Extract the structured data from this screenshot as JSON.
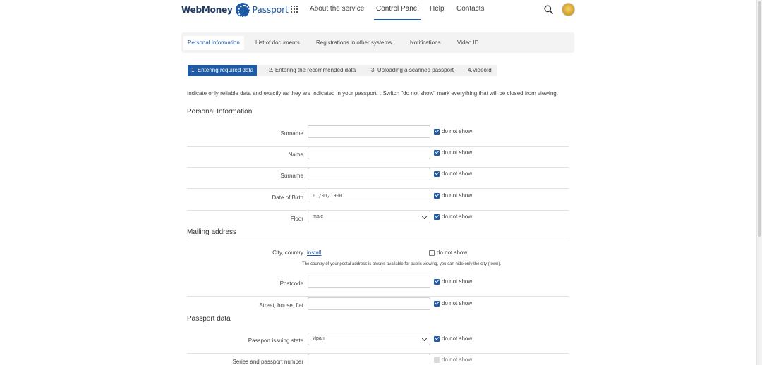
{
  "header": {
    "logo_text": "WebMoney",
    "logo_product": "Passport",
    "nav": [
      "About the service",
      "Control Panel",
      "Help",
      "Contacts"
    ],
    "active_nav": "Control Panel",
    "icons": [
      "apps-grid-icon",
      "search-icon",
      "avatar"
    ]
  },
  "tabs": [
    "Personal Information",
    "List of documents",
    "Registrations in other systems",
    "Notifications",
    "Video ID"
  ],
  "steps": [
    "1. Entering required data",
    "2. Entering the recommended data",
    "3. Uploading a scanned passport",
    "4.VideoId"
  ],
  "intro": "Indicate only reliable data and exactly as they are indicated in your passport. . Switch \"do not show\" mark everything that will be closed from viewing.",
  "sections": {
    "personal": "Personal Information",
    "mailing": "Mailing address",
    "passport": "Passport data"
  },
  "checkbox_label": "do not show",
  "fields": {
    "surname1": {
      "label": "Surname",
      "value": ""
    },
    "name": {
      "label": "Name",
      "value": ""
    },
    "surname2": {
      "label": "Surname",
      "value": ""
    },
    "dob": {
      "label": "Date of Birth",
      "value": "01/01/1900"
    },
    "floor": {
      "label": "Floor",
      "value": "male"
    },
    "city": {
      "label": "City, country",
      "link": "install"
    },
    "postcode": {
      "label": "Postcode",
      "value": ""
    },
    "street": {
      "label": "Street, house, flat",
      "value": ""
    },
    "issuing_state": {
      "label": "Passport issuing state",
      "value": "Иран"
    },
    "series": {
      "label": "Series and passport number",
      "value": ""
    }
  },
  "city_note": "The country of your postal address is always available for public viewing, you can hide only the city (town).",
  "colors": {
    "accent": "#1f5aa6",
    "border": "#cfcfcf",
    "tab_bg": "#f3f3f3"
  }
}
